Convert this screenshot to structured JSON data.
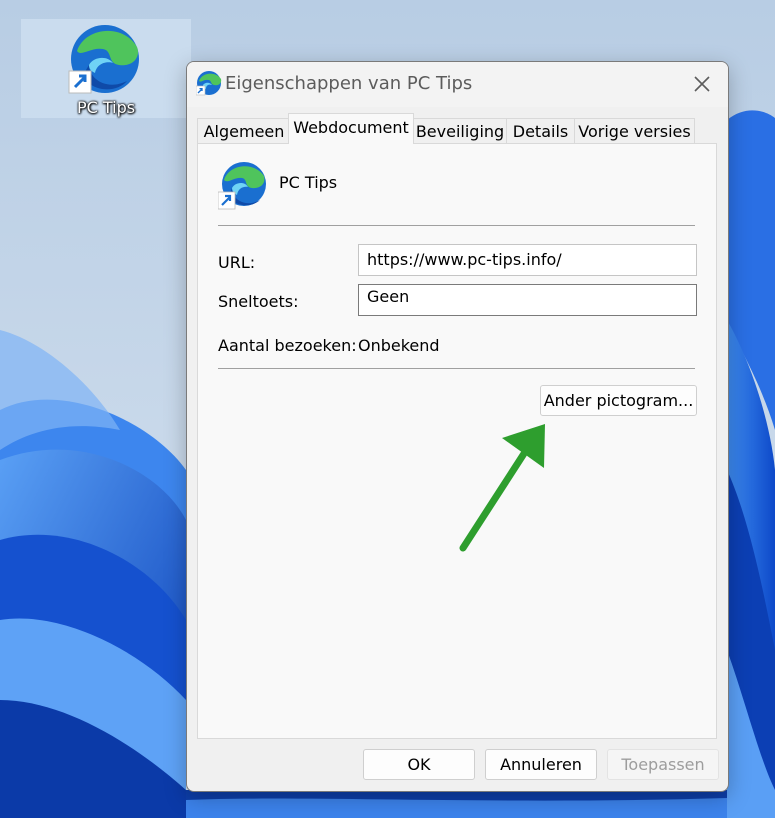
{
  "desktop": {
    "shortcut_label": "PC Tips",
    "shortcut_icon": "edge-icon"
  },
  "dialog": {
    "title": "Eigenschappen van PC Tips",
    "title_icon": "edge-icon",
    "close_icon": "close-icon",
    "tabs": [
      {
        "label": "Algemeen",
        "active": false
      },
      {
        "label": "Webdocument",
        "active": true
      },
      {
        "label": "Beveiliging",
        "active": false
      },
      {
        "label": "Details",
        "active": false
      },
      {
        "label": "Vorige versies",
        "active": false
      }
    ],
    "shortcut_name": "PC Tips",
    "url_label": "URL:",
    "url_value": "https://www.pc-tips.info/",
    "hotkey_label": "Sneltoets:",
    "hotkey_value": "Geen",
    "visits_label": "Aantal bezoeken:",
    "visits_value": "Onbekend",
    "change_icon_button": "Ander pictogram...",
    "ok_button": "OK",
    "cancel_button": "Annuleren",
    "apply_button": "Toepassen"
  },
  "colors": {
    "arrow": "#2e9e2e",
    "edge_blue": "#1a6fd0",
    "edge_green": "#4fc45c",
    "wallpaper_blue": "#1f63d8"
  }
}
